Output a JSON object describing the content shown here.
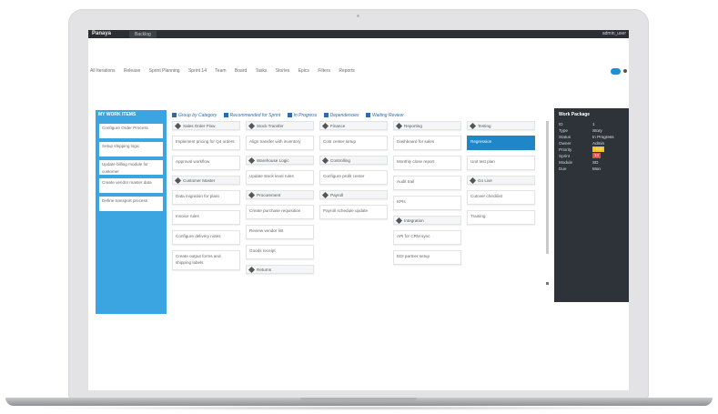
{
  "app": {
    "brand": "Panaya",
    "active_tab": "Backlog",
    "user": "admin_user"
  },
  "breadcrumbs": [
    "All Iterations",
    "Release",
    "Sprint Planning",
    "Sprint 14",
    "Team",
    "Board",
    "Tasks",
    "Stories",
    "Epics",
    "Filters",
    "Reports"
  ],
  "left_column": {
    "header": "MY WORK ITEMS",
    "cards": [
      "Configure Order Process",
      "Setup shipping logic",
      "Update billing module for customer",
      "Create vendor master data",
      "Define transport process"
    ]
  },
  "filters": [
    "Group by Category",
    "Recommended for Sprint",
    "In Progress",
    "Dependencies",
    "Waiting Review"
  ],
  "columns": [
    {
      "items": [
        {
          "type": "hdr",
          "text": "Sales Order Flow"
        },
        {
          "type": "card",
          "text": "Implement pricing for Q4 orders"
        },
        {
          "type": "card",
          "text": "Approval workflow"
        },
        {
          "type": "hdr",
          "text": "Customer Master"
        },
        {
          "type": "card",
          "text": "Data migration for plant"
        },
        {
          "type": "card",
          "text": "Invoice rules"
        },
        {
          "type": "card",
          "text": "Configure delivery notes"
        },
        {
          "type": "tall",
          "text": "Create output forms and shipping labels"
        }
      ]
    },
    {
      "items": [
        {
          "type": "hdr",
          "text": "Stock Transfer"
        },
        {
          "type": "card",
          "text": "Align transfer with inventory"
        },
        {
          "type": "hdr",
          "text": "Warehouse Logic"
        },
        {
          "type": "card",
          "text": "Update stock level rules"
        },
        {
          "type": "hdr",
          "text": "Procurement"
        },
        {
          "type": "card",
          "text": "Create purchase requisition"
        },
        {
          "type": "card",
          "text": "Review vendor list"
        },
        {
          "type": "card",
          "text": "Goods receipt"
        },
        {
          "type": "hdr",
          "text": "Returns"
        }
      ]
    },
    {
      "items": [
        {
          "type": "hdr",
          "text": "Finance"
        },
        {
          "type": "card",
          "text": "Cost center setup"
        },
        {
          "type": "hdr",
          "text": "Controlling"
        },
        {
          "type": "card",
          "text": "Configure profit center"
        },
        {
          "type": "hdr",
          "text": "Payroll"
        },
        {
          "type": "card",
          "text": "Payroll schedule update"
        }
      ]
    },
    {
      "items": [
        {
          "type": "hdr",
          "text": "Reporting"
        },
        {
          "type": "card",
          "text": "Dashboard for sales"
        },
        {
          "type": "card",
          "text": "Monthly close report"
        },
        {
          "type": "card",
          "text": "Audit trail"
        },
        {
          "type": "card",
          "text": "KPIs"
        },
        {
          "type": "hdr",
          "text": "Integration"
        },
        {
          "type": "card",
          "text": "API for CRM sync"
        },
        {
          "type": "card",
          "text": "EDI partner setup"
        }
      ]
    },
    {
      "items": [
        {
          "type": "hdr",
          "text": "Testing"
        },
        {
          "type": "sel",
          "text": "Regression"
        },
        {
          "type": "card",
          "text": "Unit test plan"
        },
        {
          "type": "hdr",
          "text": "Go Live"
        },
        {
          "type": "card",
          "text": "Cutover checklist"
        },
        {
          "type": "card",
          "text": "Training"
        }
      ]
    }
  ],
  "details_panel": {
    "title": "Work Package",
    "rows": [
      {
        "label": "ID",
        "value": "1"
      },
      {
        "label": "Type",
        "value": "Story"
      },
      {
        "label": "Status",
        "value": "In Progress"
      },
      {
        "label": "Owner",
        "value": "Admin"
      },
      {
        "label": "Priority",
        "value": "High"
      },
      {
        "label": "Sprint",
        "value": "14"
      },
      {
        "label": "Module",
        "value": "SD"
      },
      {
        "label": "Due",
        "value": "Mon"
      }
    ],
    "colors": {
      "accent": "#1f86c8",
      "badge_yellow": "#f0c419",
      "badge_red": "#d9534f"
    }
  }
}
